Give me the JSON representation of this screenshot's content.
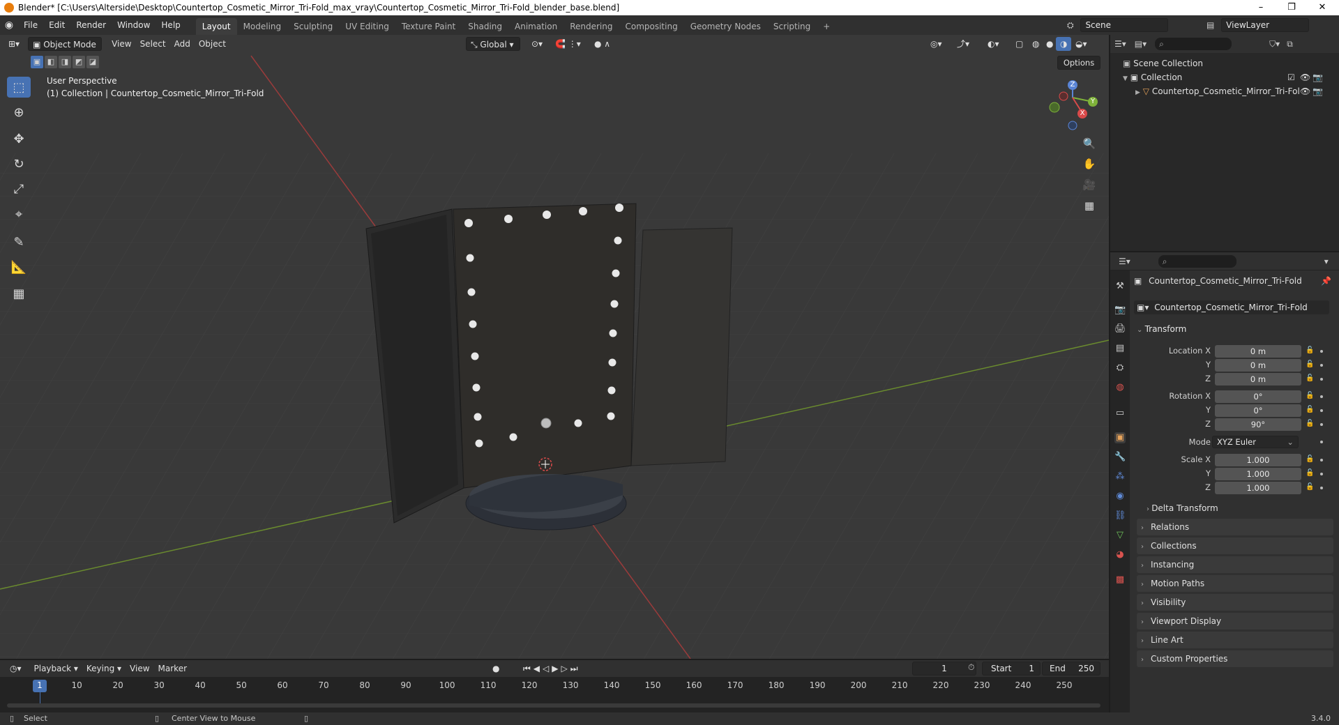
{
  "window": {
    "title": "Blender* [C:\\Users\\Alterside\\Desktop\\Countertop_Cosmetic_Mirror_Tri-Fold_max_vray\\Countertop_Cosmetic_Mirror_Tri-Fold_blender_base.blend]",
    "minimize": "–",
    "restore": "❐",
    "close": "✕"
  },
  "menus": [
    "File",
    "Edit",
    "Render",
    "Window",
    "Help"
  ],
  "workspaces": [
    "Layout",
    "Modeling",
    "Sculpting",
    "UV Editing",
    "Texture Paint",
    "Shading",
    "Animation",
    "Rendering",
    "Compositing",
    "Geometry Nodes",
    "Scripting",
    "+"
  ],
  "active_workspace": "Layout",
  "scene": {
    "label": "Scene",
    "viewlayer": "ViewLayer"
  },
  "viewport": {
    "mode": "Object Mode",
    "menus": [
      "View",
      "Select",
      "Add",
      "Object"
    ],
    "orientation": "Global",
    "options": "Options",
    "overlay_title": "User Perspective",
    "overlay_subtitle": "(1) Collection | Countertop_Cosmetic_Mirror_Tri-Fold",
    "gizmo": {
      "x": "X",
      "y": "Y",
      "z": "Z"
    }
  },
  "outliner": {
    "root": "Scene Collection",
    "collection": "Collection",
    "object": "Countertop_Cosmetic_Mirror_Tri-Fol"
  },
  "properties": {
    "object_name": "Countertop_Cosmetic_Mirror_Tri-Fold",
    "datablock": "Countertop_Cosmetic_Mirror_Tri-Fold",
    "transform_label": "Transform",
    "location": {
      "label_x": "Location X",
      "label_y": "Y",
      "label_z": "Z",
      "x": "0 m",
      "y": "0 m",
      "z": "0 m"
    },
    "rotation": {
      "label_x": "Rotation X",
      "label_y": "Y",
      "label_z": "Z",
      "x": "0°",
      "y": "0°",
      "z": "90°"
    },
    "mode_label": "Mode",
    "mode_value": "XYZ Euler",
    "scale": {
      "label_x": "Scale X",
      "label_y": "Y",
      "label_z": "Z",
      "x": "1.000",
      "y": "1.000",
      "z": "1.000"
    },
    "delta": "Delta Transform",
    "panels": [
      "Relations",
      "Collections",
      "Instancing",
      "Motion Paths",
      "Visibility",
      "Viewport Display",
      "Line Art",
      "Custom Properties"
    ]
  },
  "timeline": {
    "menus": [
      "Playback",
      "Keying",
      "View",
      "Marker"
    ],
    "current_frame": "1",
    "start_label": "Start",
    "start": "1",
    "end_label": "End",
    "end": "250",
    "ticks": [
      "1",
      "10",
      "20",
      "30",
      "40",
      "50",
      "60",
      "70",
      "80",
      "90",
      "100",
      "110",
      "120",
      "130",
      "140",
      "150",
      "160",
      "170",
      "180",
      "190",
      "200",
      "210",
      "220",
      "230",
      "240",
      "250"
    ]
  },
  "status": {
    "left": "Select",
    "middle": "Center View to Mouse",
    "version": "3.4.0"
  }
}
